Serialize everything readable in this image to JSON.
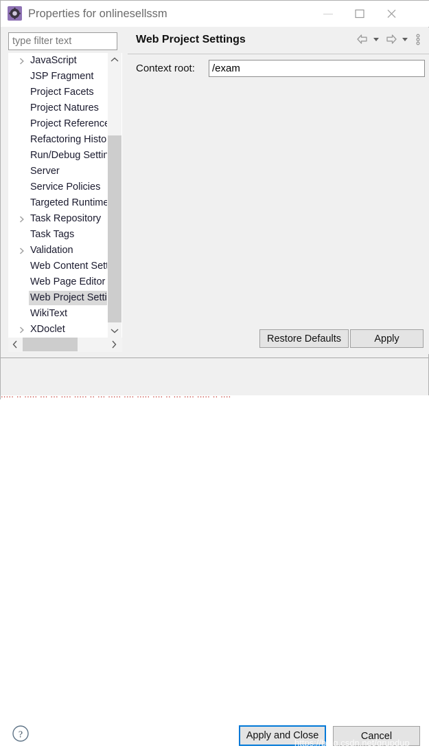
{
  "window": {
    "title": "Properties for onlinesellssm",
    "icon": "properties-gear-icon",
    "minimize_label": "Minimize",
    "maximize_label": "Maximize",
    "close_label": "Close"
  },
  "filter": {
    "placeholder": "type filter text",
    "value": ""
  },
  "tree": {
    "items": [
      {
        "label": "JavaScript",
        "expandable": true,
        "selected": false
      },
      {
        "label": "JSP Fragment",
        "expandable": false,
        "selected": false
      },
      {
        "label": "Project Facets",
        "expandable": false,
        "selected": false
      },
      {
        "label": "Project Natures",
        "expandable": false,
        "selected": false
      },
      {
        "label": "Project References",
        "expandable": false,
        "selected": false
      },
      {
        "label": "Refactoring History",
        "expandable": false,
        "selected": false
      },
      {
        "label": "Run/Debug Settings",
        "expandable": false,
        "selected": false
      },
      {
        "label": "Server",
        "expandable": false,
        "selected": false
      },
      {
        "label": "Service Policies",
        "expandable": false,
        "selected": false
      },
      {
        "label": "Targeted Runtimes",
        "expandable": false,
        "selected": false
      },
      {
        "label": "Task Repository",
        "expandable": true,
        "selected": false
      },
      {
        "label": "Task Tags",
        "expandable": false,
        "selected": false
      },
      {
        "label": "Validation",
        "expandable": true,
        "selected": false
      },
      {
        "label": "Web Content Settings",
        "expandable": false,
        "selected": false
      },
      {
        "label": "Web Page Editor",
        "expandable": false,
        "selected": false
      },
      {
        "label": "Web Project Settings",
        "expandable": false,
        "selected": true
      },
      {
        "label": "WikiText",
        "expandable": false,
        "selected": false
      },
      {
        "label": "XDoclet",
        "expandable": true,
        "selected": false
      }
    ]
  },
  "panel": {
    "title": "Web Project Settings",
    "toolbar": {
      "back_icon": "arrow-left-icon",
      "back_dropdown_icon": "chevron-down-icon",
      "forward_icon": "arrow-right-icon",
      "forward_dropdown_icon": "chevron-down-icon",
      "menu_icon": "vertical-dots-icon"
    },
    "context_root": {
      "label": "Context root:",
      "value": "/exam"
    },
    "restore_defaults_label": "Restore Defaults",
    "apply_label": "Apply"
  },
  "footer": {
    "help_icon": "question-mark-circle-icon",
    "apply_and_close_label": "Apply and Close",
    "cancel_label": "Cancel",
    "watermark": "https://blog.csdn.net/grupdup"
  }
}
